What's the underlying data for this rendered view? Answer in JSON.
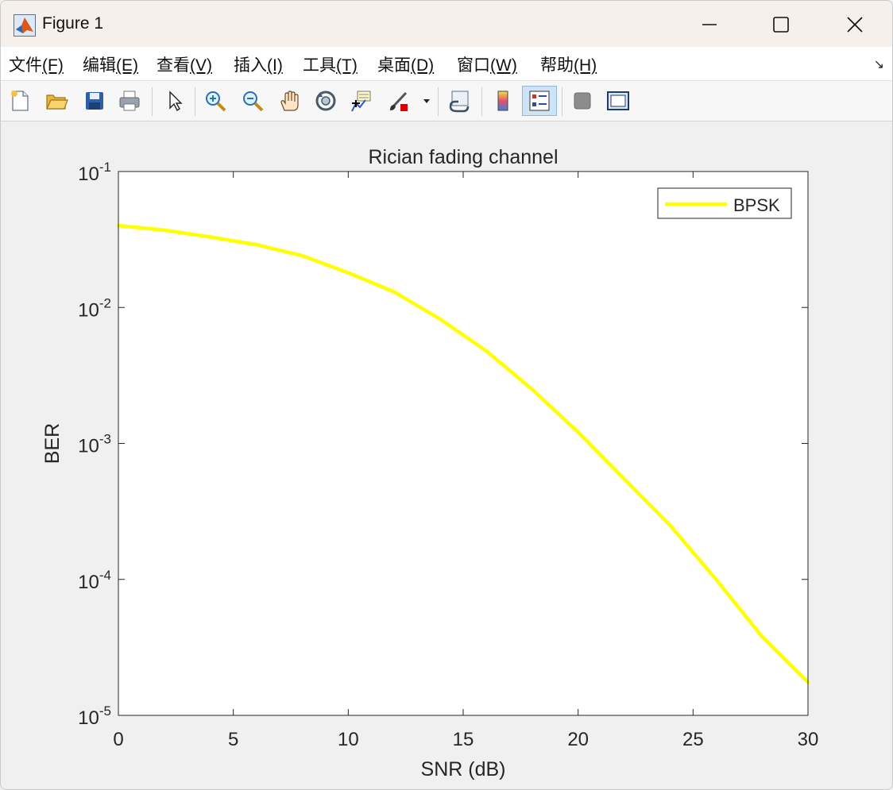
{
  "window": {
    "title": "Figure 1"
  },
  "menu": [
    {
      "label": "文件",
      "key": "(F)"
    },
    {
      "label": "编辑",
      "key": "(E)"
    },
    {
      "label": "查看",
      "key": "(V)"
    },
    {
      "label": "插入",
      "key": "(I)"
    },
    {
      "label": "工具",
      "key": "(T)"
    },
    {
      "label": "桌面",
      "key": "(D)"
    },
    {
      "label": "窗口",
      "key": "(W)"
    },
    {
      "label": "帮助",
      "key": "(H)"
    }
  ],
  "toolbar_icons": [
    "new-figure-icon",
    "open-file-icon",
    "save-icon",
    "print-icon",
    "pointer-icon",
    "zoom-in-icon",
    "zoom-out-icon",
    "pan-hand-icon",
    "rotate-3d-icon",
    "data-cursor-icon",
    "brush-icon",
    "link-plot-icon",
    "colorbar-icon",
    "legend-icon",
    "hide-plot-tools-icon",
    "show-plot-tools-icon"
  ],
  "chart_data": {
    "type": "line",
    "title": "Rician fading channel",
    "xlabel": "SNR (dB)",
    "ylabel": "BER",
    "xlim": [
      0,
      30
    ],
    "ylim": [
      1e-05,
      0.1
    ],
    "yscale": "log",
    "xticks": [
      0,
      5,
      10,
      15,
      20,
      25,
      30
    ],
    "yticks": [
      {
        "base": "10",
        "exp": "-1",
        "value": 0.1
      },
      {
        "base": "10",
        "exp": "-2",
        "value": 0.01
      },
      {
        "base": "10",
        "exp": "-3",
        "value": 0.001
      },
      {
        "base": "10",
        "exp": "-4",
        "value": 0.0001
      },
      {
        "base": "10",
        "exp": "-5",
        "value": 1e-05
      }
    ],
    "legend_position": "top-right",
    "grid": false,
    "series": [
      {
        "name": "BPSK",
        "color": "#ffff00",
        "x": [
          0,
          2,
          4,
          6,
          8,
          10,
          12,
          14,
          16,
          18,
          20,
          22,
          24,
          26,
          28,
          30
        ],
        "y": [
          0.04,
          0.037,
          0.033,
          0.029,
          0.024,
          0.018,
          0.013,
          0.0082,
          0.0048,
          0.0025,
          0.00121,
          0.00055,
          0.00025,
          0.0001,
          3.8e-05,
          1.75e-05
        ]
      }
    ]
  }
}
